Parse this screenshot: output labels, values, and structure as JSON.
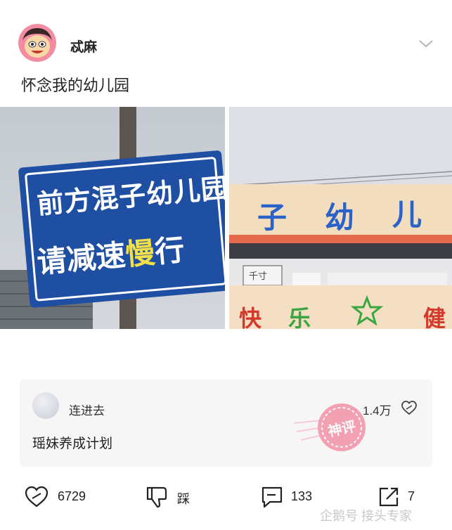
{
  "post": {
    "author": "忒麻",
    "text": "怀念我的幼儿园"
  },
  "images": {
    "left": {
      "sign_line1": "前方混子幼儿园",
      "sign_line2_part1": "请减速",
      "sign_line2_highlight": "慢",
      "sign_line2_part2": "行"
    },
    "right": {
      "top_chars": [
        "子",
        "幼",
        "儿"
      ],
      "bottom_chars": [
        "快",
        "乐",
        "健"
      ],
      "small_sign": "千寸"
    }
  },
  "comment": {
    "name": "连进去",
    "text": "瑶妹养成计划",
    "likes": "1.4万",
    "stamp_text": "神评"
  },
  "actions": {
    "like_count": "6729",
    "dislike_label": "踩",
    "comment_count": "133",
    "share_count": "7"
  },
  "watermark": "企鹅号 接头专家",
  "colors": {
    "sign_blue": "#1f4fa3",
    "sign_highlight": "#f2e04a",
    "banner_blue": "#2a62c8",
    "banner_red": "#d33a2c",
    "banner_green": "#3aa640",
    "stamp_pink": "#f15b7b"
  }
}
